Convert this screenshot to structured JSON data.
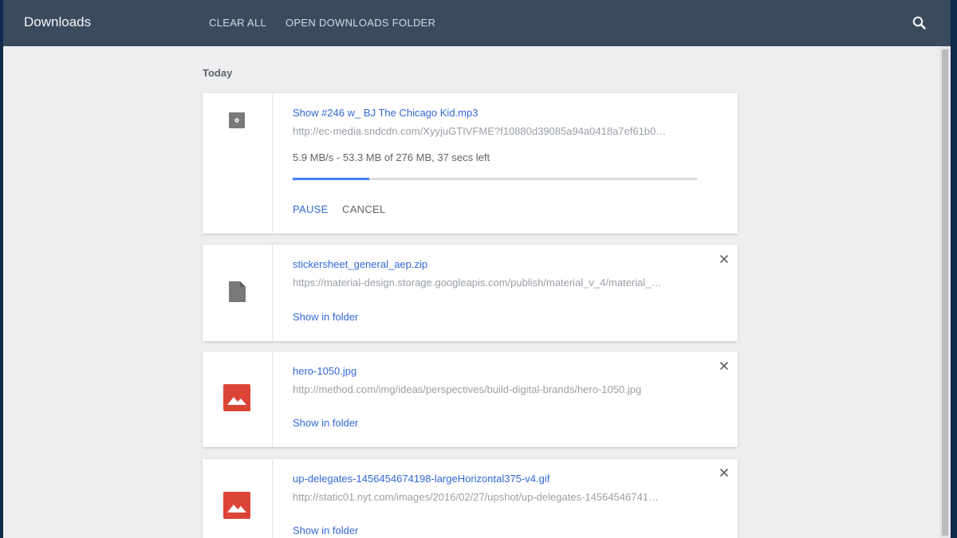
{
  "header": {
    "title": "Downloads",
    "clear_all": "CLEAR ALL",
    "open_folder": "OPEN DOWNLOADS FOLDER"
  },
  "section": {
    "label": "Today"
  },
  "downloads": [
    {
      "name": "Show #246 w_ BJ The Chicago Kid.mp3",
      "url": "http://ec-media.sndcdn.com/XyyjuGTIVFME?f10880d39085a94a0418a7ef61b0…",
      "status": "5.9 MB/s - 53.3 MB of 276 MB, 37 secs left",
      "progress": 0.19,
      "pause": "PAUSE",
      "cancel": "CANCEL",
      "icon": "audio-file-icon"
    },
    {
      "name": "stickersheet_general_aep.zip",
      "url": "https://material-design.storage.googleapis.com/publish/material_v_4/material_…",
      "action": "Show in folder",
      "icon": "file-icon"
    },
    {
      "name": "hero-1050.jpg",
      "url": "http://method.com/img/ideas/perspectives/build-digital-brands/hero-1050.jpg",
      "action": "Show in folder",
      "icon": "image-icon"
    },
    {
      "name": "up-delegates-1456454674198-largeHorizontal375-v4.gif",
      "url": "http://static01.nyt.com/images/2016/02/27/upshot/up-delegates-14564546741…",
      "action": "Show in folder",
      "icon": "image-icon"
    }
  ],
  "colors": {
    "header_bg": "#3b4b5e",
    "link": "#3367d6",
    "progress": "#4285f4",
    "image_icon": "#db4437"
  }
}
